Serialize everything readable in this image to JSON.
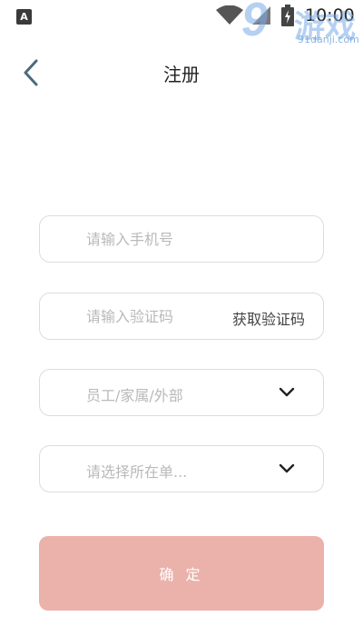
{
  "status_bar": {
    "notification_icon": "A",
    "time": "10:00",
    "icons": [
      "wifi-icon",
      "signal-icon",
      "battery-charging-icon"
    ]
  },
  "watermark": {
    "number": "9",
    "text": "游戏",
    "url": "91danji.com"
  },
  "header": {
    "title": "注册",
    "back_icon": "chevron-left-icon"
  },
  "form": {
    "phone": {
      "placeholder": "请输入手机号",
      "value": ""
    },
    "code": {
      "placeholder": "请输入验证码",
      "value": "",
      "get_code_label": "获取验证码"
    },
    "identity": {
      "placeholder": "员工/家属/外部"
    },
    "unit": {
      "placeholder": "请选择所在单..."
    }
  },
  "confirm": {
    "label": "确 定"
  },
  "colors": {
    "accent_button": "#ebb1ab",
    "field_border": "#dcdcdc",
    "placeholder": "#b9b9b9",
    "back_arrow": "#4e6a7d"
  }
}
